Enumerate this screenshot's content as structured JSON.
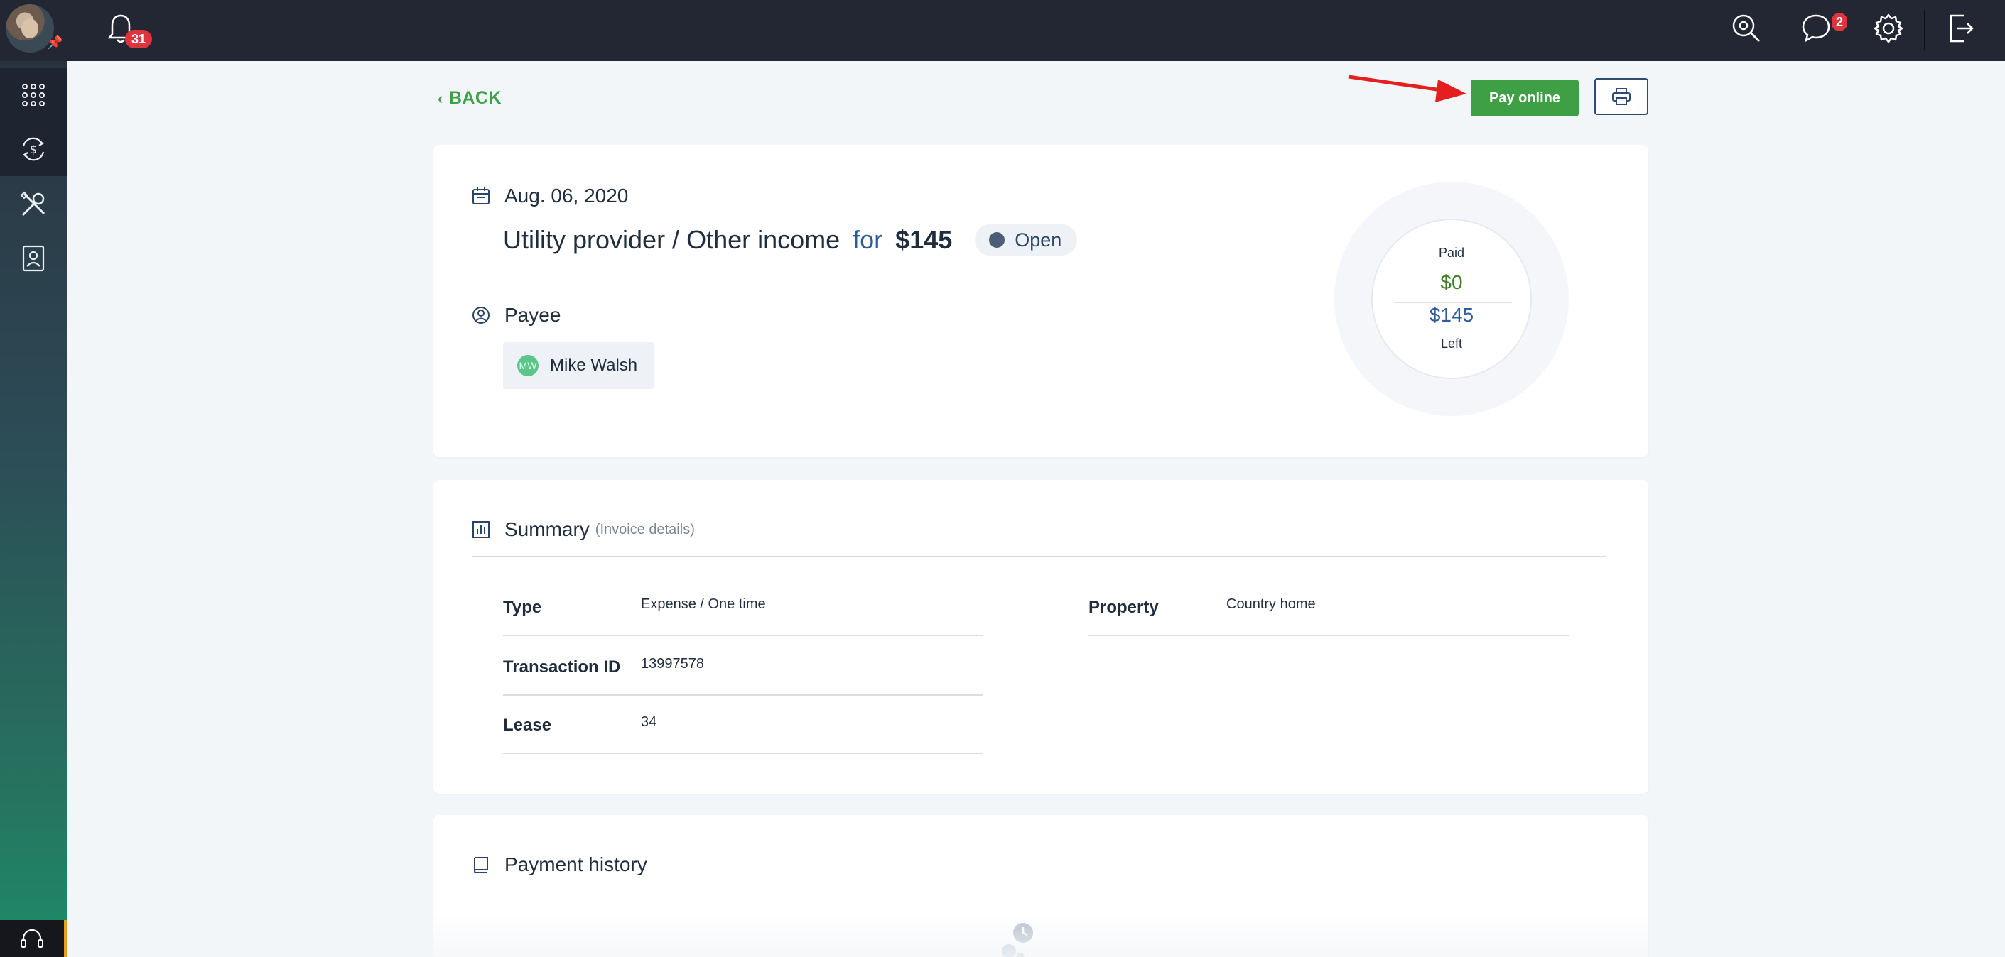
{
  "topbar": {
    "notifications_count": "31",
    "messages_count": "2",
    "icons": [
      "bell-icon",
      "search-icon",
      "chat-icon",
      "gear-icon",
      "logout-icon"
    ]
  },
  "sidebar": {
    "items": [
      "apps-grid-icon",
      "money-exchange-icon",
      "tools-icon",
      "contacts-icon"
    ],
    "bottom": "headset-icon"
  },
  "header": {
    "back_label": "BACK",
    "pay_online_label": "Pay online"
  },
  "transaction": {
    "date": "Aug. 06, 2020",
    "title": "Utility provider / Other income",
    "for_word": "for",
    "amount": "$145",
    "status": "Open",
    "payee_label": "Payee",
    "payee_initials": "MW",
    "payee_name": "Mike Walsh",
    "paid_label": "Paid",
    "paid_value": "$0",
    "left_value": "$145",
    "left_label": "Left"
  },
  "summary": {
    "title": "Summary",
    "subtitle": "(Invoice details)",
    "left_rows": [
      {
        "key": "Type",
        "value": "Expense / One time"
      },
      {
        "key": "Transaction ID",
        "value": "13997578"
      },
      {
        "key": "Lease",
        "value": "34"
      }
    ],
    "right_rows": [
      {
        "key": "Property",
        "value": "Country home"
      }
    ]
  },
  "payment_history": {
    "title": "Payment history"
  },
  "colors": {
    "topbar": "#222733",
    "accent_green": "#3e9f45",
    "link_blue": "#2f5a9c",
    "badge_red": "#e0343c"
  }
}
